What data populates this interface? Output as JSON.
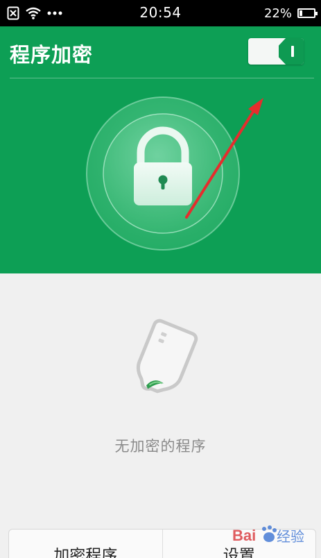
{
  "status_bar": {
    "time": "20:54",
    "battery_text": "22%",
    "battery_level": 0.22,
    "icons": [
      "sim-disabled-icon",
      "wifi-icon",
      "more-dots-icon",
      "battery-icon"
    ]
  },
  "header": {
    "title": "程序加密",
    "toggle_state": "on"
  },
  "hero": {
    "icon": "padlock-icon",
    "annotation": "red-arrow-pointing-to-toggle"
  },
  "empty_state": {
    "icon": "empty-tag-icon",
    "message": "无加密的程序"
  },
  "bottom_buttons": {
    "encrypt_programs": "加密程序",
    "settings": "设置"
  },
  "watermark": {
    "text": "Bai 经验",
    "colors": {
      "paw": "#d6262b",
      "text": "#2f6bd0"
    }
  },
  "colors": {
    "primary_green": "#0d9f55",
    "background": "#f0f0f0",
    "annotation_red": "#e52d2d"
  }
}
